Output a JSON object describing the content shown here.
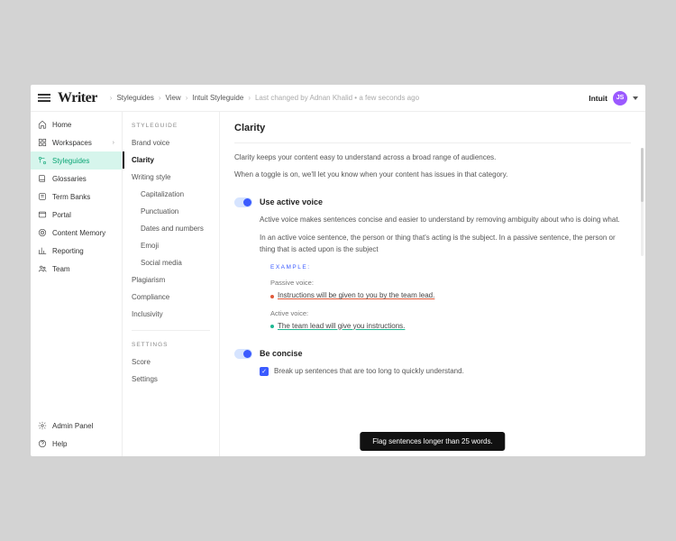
{
  "header": {
    "logo": "Writer",
    "breadcrumb": [
      "Styleguides",
      "View",
      "Intuit Styleguide"
    ],
    "last_changed": "Last changed by Adnan Khalid • a few seconds ago",
    "org": "Intuit",
    "avatar_initials": "JS"
  },
  "sidebar": {
    "top": [
      {
        "label": "Home"
      },
      {
        "label": "Workspaces",
        "expandable": true
      },
      {
        "label": "Styleguides",
        "active": true
      },
      {
        "label": "Glossaries"
      },
      {
        "label": "Term Banks"
      },
      {
        "label": "Portal"
      },
      {
        "label": "Content Memory"
      },
      {
        "label": "Reporting"
      },
      {
        "label": "Team"
      }
    ],
    "bottom": [
      {
        "label": "Admin Panel"
      },
      {
        "label": "Help"
      }
    ]
  },
  "subnav": {
    "heading_styleguide": "STYLEGUIDE",
    "heading_settings": "SETTINGS",
    "styleguide_items": [
      {
        "label": "Brand voice"
      },
      {
        "label": "Clarity",
        "active": true
      },
      {
        "label": "Writing style"
      },
      {
        "label": "Capitalization",
        "child": true
      },
      {
        "label": "Punctuation",
        "child": true
      },
      {
        "label": "Dates and numbers",
        "child": true
      },
      {
        "label": "Emoji",
        "child": true
      },
      {
        "label": "Social media",
        "child": true
      },
      {
        "label": "Plagiarism"
      },
      {
        "label": "Compliance"
      },
      {
        "label": "Inclusivity"
      }
    ],
    "settings_items": [
      {
        "label": "Score"
      },
      {
        "label": "Settings"
      }
    ]
  },
  "main": {
    "title": "Clarity",
    "intro_1": "Clarity keeps your content easy to understand across a broad range of audiences.",
    "intro_2": "When a toggle is on, we'll let you know when your content has issues in that category.",
    "sections": [
      {
        "title": "Use active voice",
        "toggle_on": true,
        "paragraphs": [
          "Active voice makes sentences concise and easier to understand by removing ambiguity about who is doing what.",
          "In an active voice sentence, the person or thing that's acting is the subject. In a passive sentence, the person or thing that is acted upon is the subject"
        ],
        "example_label": "EXAMPLE:",
        "passive_label": "Passive voice:",
        "passive_text": "Instructions will be given to you by the team lead.",
        "active_label": "Active voice:",
        "active_text": "The team lead will give you instructions."
      },
      {
        "title": "Be concise",
        "toggle_on": true,
        "checkbox_label": "Break up sentences that are too long to quickly understand."
      }
    ],
    "tooltip": "Flag sentences longer than 25 words."
  },
  "colors": {
    "accent_purple": "#9b59ff",
    "accent_blue": "#3b5bff",
    "accent_teal": "#0aa574"
  }
}
